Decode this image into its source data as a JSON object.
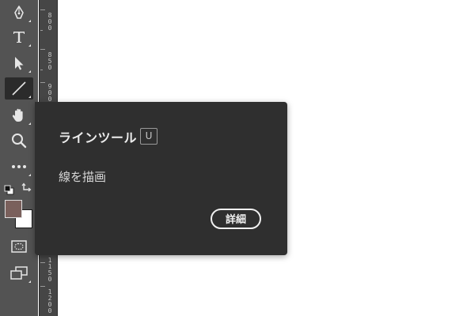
{
  "toolbar": {
    "tools": [
      {
        "name": "pen-tool",
        "icon": "pen-icon"
      },
      {
        "name": "type-tool",
        "icon": "type-icon"
      },
      {
        "name": "path-selection-tool",
        "icon": "arrow-pointer-icon"
      },
      {
        "name": "line-tool",
        "icon": "line-icon",
        "active": true
      },
      {
        "name": "hand-tool",
        "icon": "hand-icon"
      },
      {
        "name": "zoom-tool",
        "icon": "magnifier-icon"
      },
      {
        "name": "edit-toolbar",
        "icon": "more-icon"
      },
      {
        "name": "quick-mask",
        "icon": "quick-mask-icon"
      },
      {
        "name": "screen-mode",
        "icon": "screen-mode-icon"
      }
    ],
    "foreground_color": "#7a605c",
    "background_color": "#ffffff"
  },
  "ruler": {
    "labels": [
      "800",
      "850",
      "900",
      "1150",
      "1200"
    ]
  },
  "tooltip": {
    "title": "ラインツール",
    "shortcut": "U",
    "description": "線を描画",
    "details_label": "詳細"
  },
  "colors": {
    "toolbar_bg": "#535353",
    "tooltip_bg": "#2f2f2f",
    "canvas_bg": "#ffffff"
  }
}
